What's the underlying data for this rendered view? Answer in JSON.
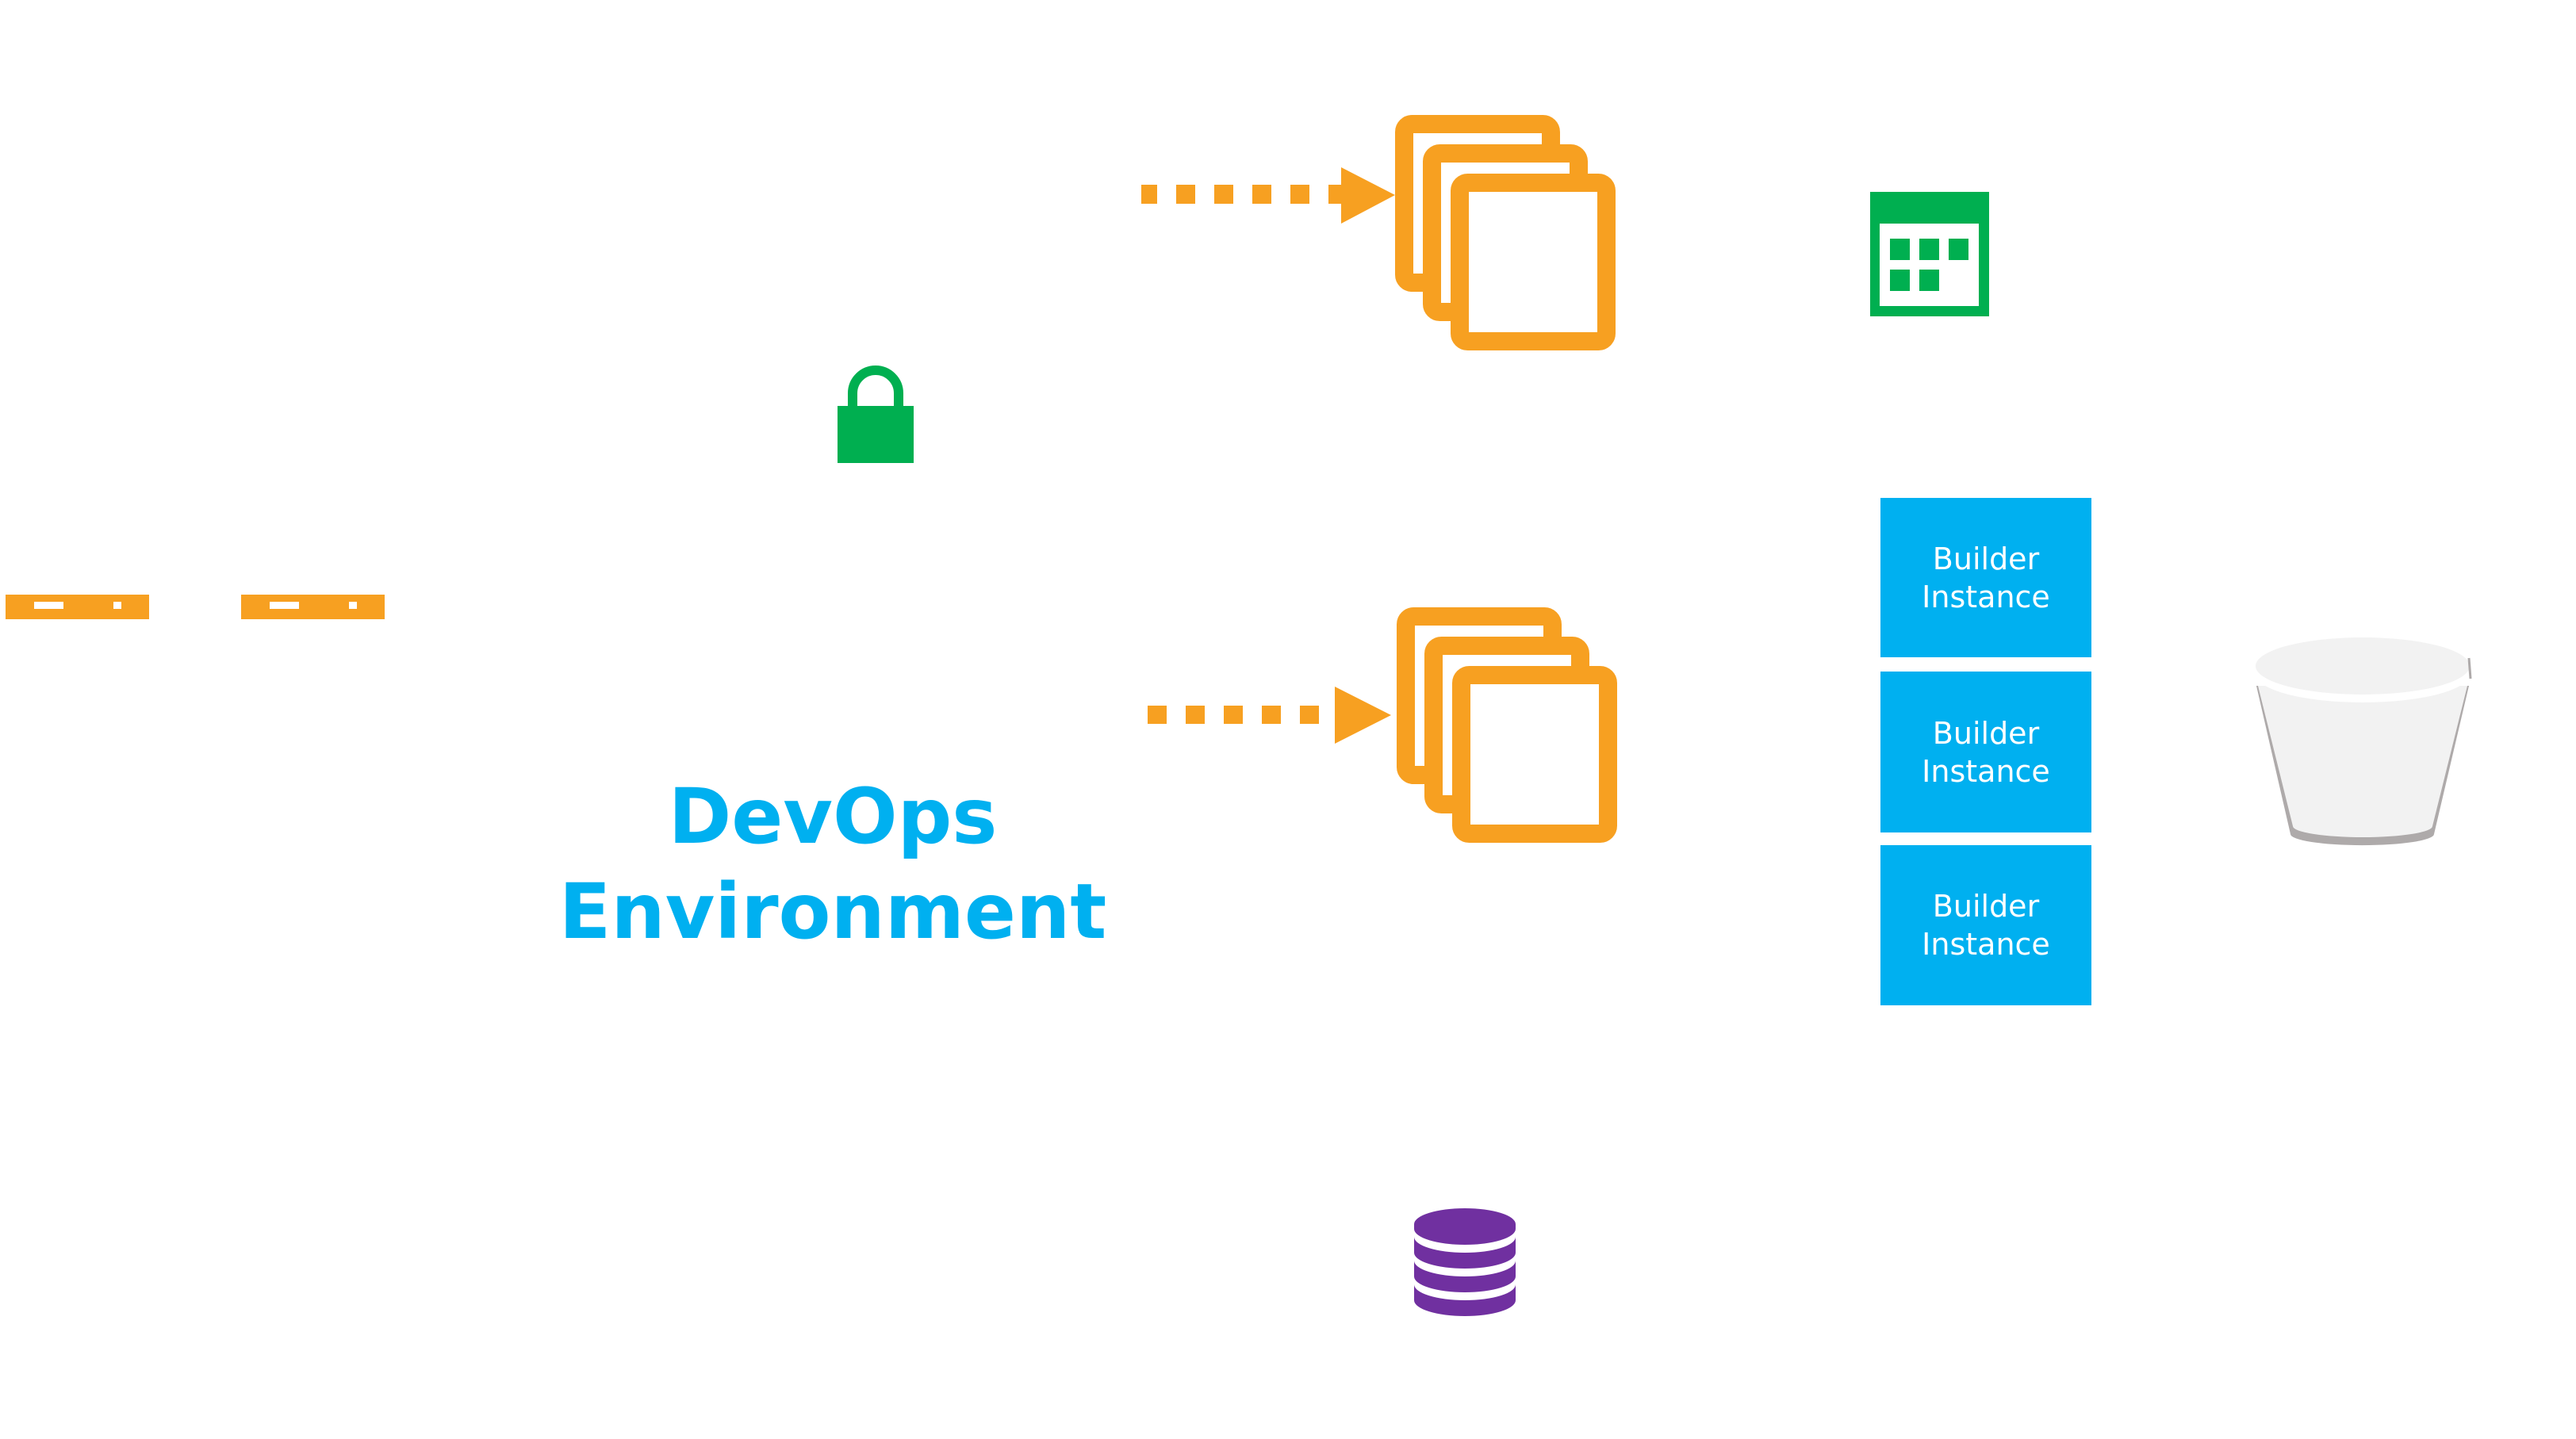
{
  "diagram": {
    "title_line1": "DevOps",
    "title_line2": "Environment",
    "builder_instances": [
      {
        "line1": "Builder",
        "line2": "Instance"
      },
      {
        "line1": "Builder",
        "line2": "Instance"
      },
      {
        "line1": "Builder",
        "line2": "Instance"
      }
    ],
    "icons": {
      "servers": [
        "server-bar-icon",
        "server-bar-icon"
      ],
      "lock": "lock-icon",
      "instance_stacks": [
        "instances-stack-icon",
        "instances-stack-icon"
      ],
      "arrows": [
        "dotted-arrow-icon",
        "dotted-arrow-icon"
      ],
      "calendar": "calendar-icon",
      "bucket": "storage-bucket-icon",
      "database": "database-icon"
    },
    "colors": {
      "orange": "#f7a021",
      "green": "#00af50",
      "blue": "#00b0f0",
      "purple": "#7030a0",
      "bucket_fill": "#f2f2f2",
      "bucket_shadow": "#aeaaaa"
    }
  }
}
